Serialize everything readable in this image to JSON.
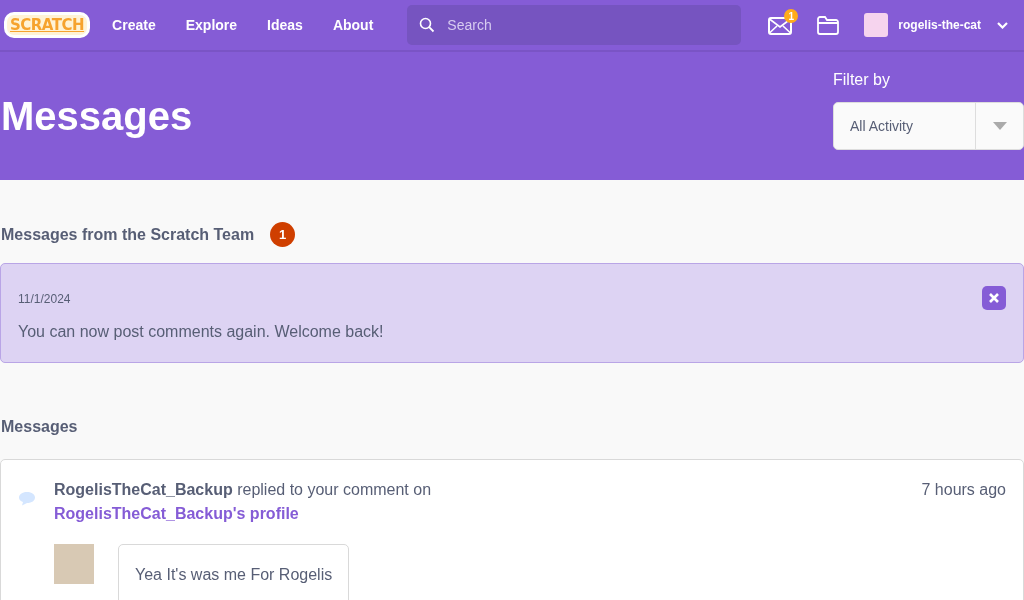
{
  "nav": {
    "logo": "SCRATCH",
    "links": [
      "Create",
      "Explore",
      "Ideas",
      "About"
    ],
    "search": {
      "placeholder": "Search"
    },
    "message_count": "1",
    "username": "rogelis-the-cat"
  },
  "header": {
    "title": "Messages",
    "filter_label": "Filter by",
    "filter_value": "All Activity"
  },
  "team_messages": {
    "heading": "Messages from the Scratch Team",
    "count": "1",
    "alerts": [
      {
        "date": "11/1/2024",
        "text": "You can now post comments again. Welcome back!"
      }
    ]
  },
  "messages": {
    "heading": "Messages",
    "items": [
      {
        "kind": "comment",
        "actor": "RogelisTheCat_Backup",
        "action": "replied to your comment on",
        "link": "RogelisTheCat_Backup's profile",
        "time": "7 hours ago",
        "comment": "Yea It's was me For Rogelis"
      }
    ]
  }
}
